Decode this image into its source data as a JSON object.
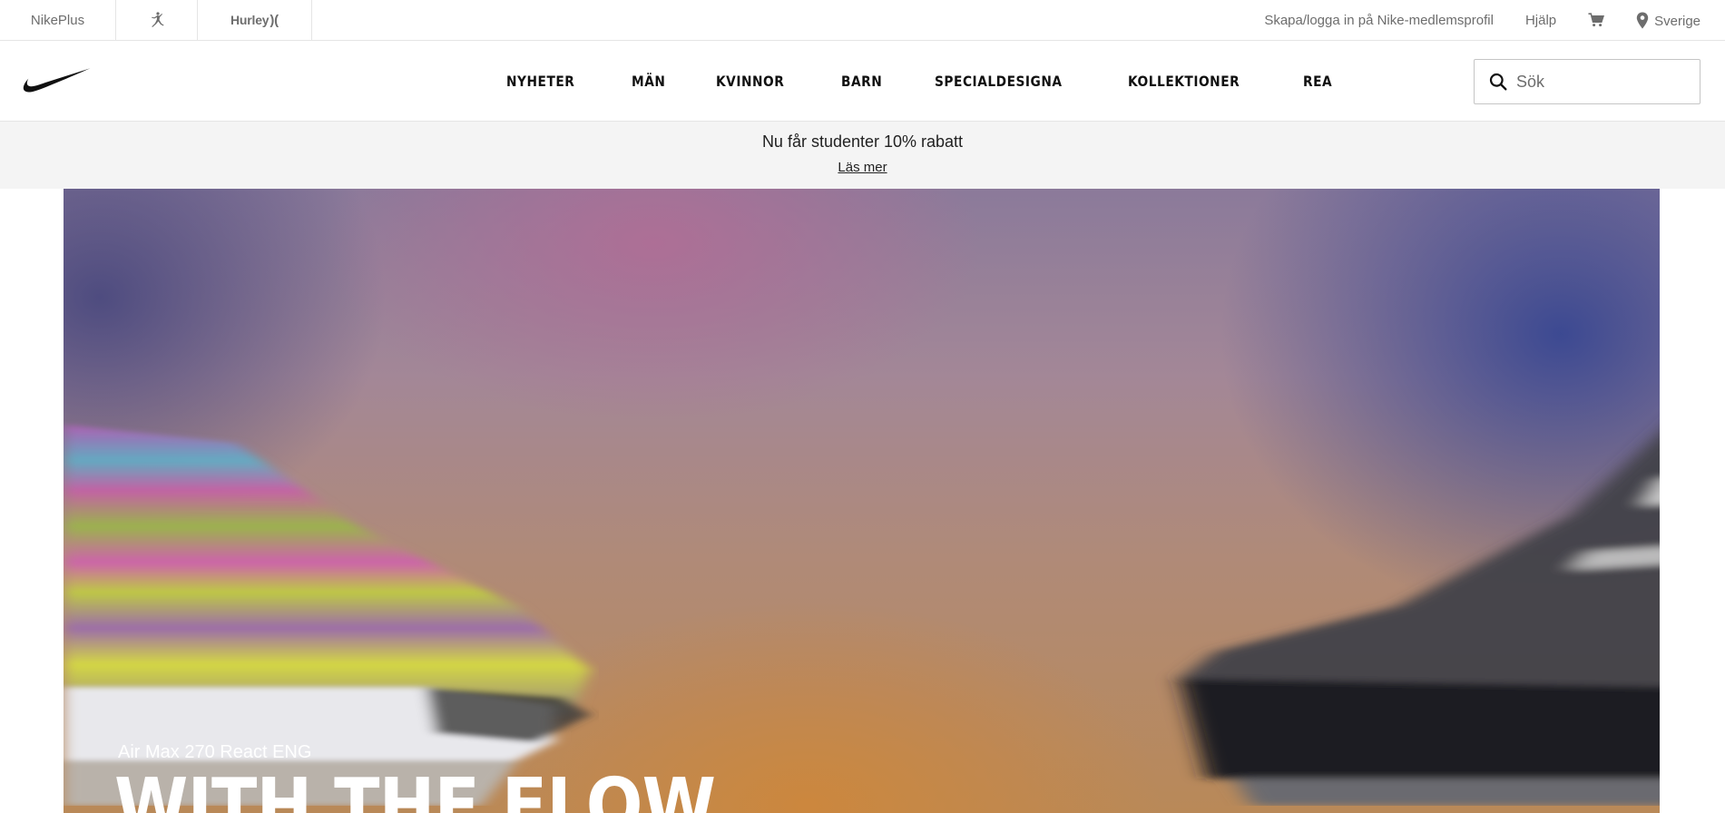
{
  "util_bar": {
    "brand_links": [
      {
        "label": "NikePlus",
        "icon": null
      },
      {
        "label": "",
        "icon": "jordan-jumpman-icon"
      },
      {
        "label": "Hurley",
        "icon": "hurley-logo-icon"
      }
    ],
    "signin_label": "Skapa/logga in på Nike-medlemsprofil",
    "help_label": "Hjälp",
    "cart_icon": "cart-icon",
    "location_icon": "location-pin-icon",
    "country_label": "Sverige"
  },
  "nav": {
    "logo": "nike-swoosh-logo",
    "items": [
      "NYHETER",
      "MÄN",
      "KVINNOR",
      "BARN",
      "SPECIALDESIGNA",
      "KOLLEKTIONER",
      "REA"
    ],
    "search_placeholder": "Sök",
    "search_icon": "search-icon"
  },
  "promo": {
    "text": "Nu får studenter 10% rabatt",
    "link_label": "Läs mer"
  },
  "hero": {
    "subtitle": "Air Max 270 React ENG",
    "title": "WITH THE FLOW"
  },
  "colors": {
    "text": "#111111",
    "muted": "#6d6d6d",
    "promo_bg": "#f4f4f4",
    "border": "#e5e5e5"
  }
}
